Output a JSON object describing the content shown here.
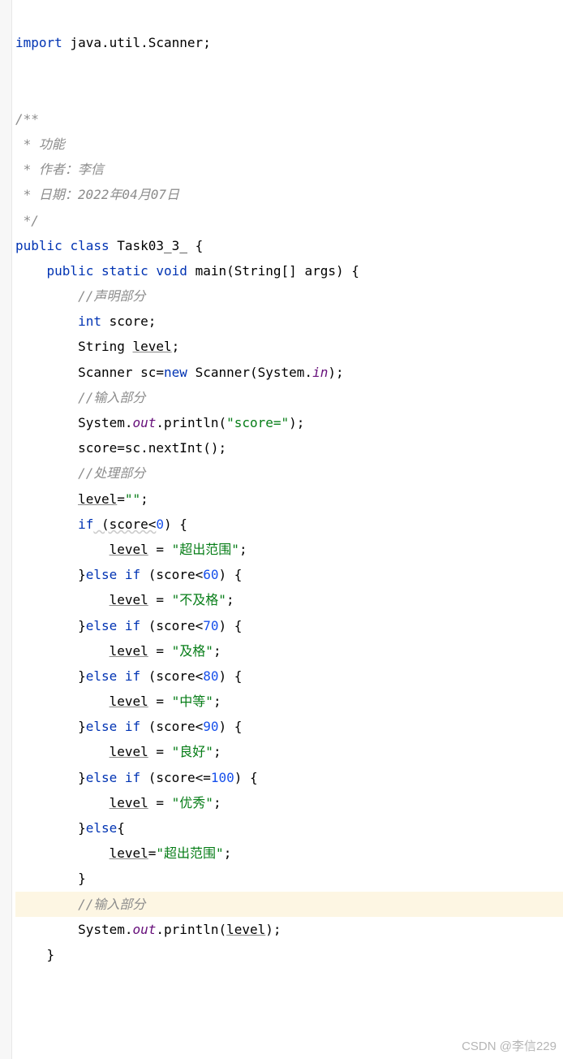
{
  "code": {
    "blank0": "",
    "import_kw": "import",
    "import_rest": " java.util.Scanner;",
    "blank1": "",
    "blank2": "",
    "jdoc_open": "/**",
    "jdoc_l1": " * 功能",
    "jdoc_l2": " * 作者：李信",
    "jdoc_l3": " * 日期：2022年04月07日",
    "jdoc_close": " */",
    "cls_kw1": "public",
    "cls_kw2": "class",
    "cls_name": "Task03_3_",
    "cls_brace": "{",
    "m_kw1": "public",
    "m_kw2": "static",
    "m_kw3": "void",
    "m_name": "main",
    "m_param": "(String[] args) {",
    "c_decl": "//声明部分",
    "d_int_kw": "int",
    "d_int_name": " score;",
    "d_str_type": "String ",
    "d_str_name": "level",
    "d_str_semi": ";",
    "sc_type": "Scanner sc=",
    "sc_new": "new",
    "sc_call": " Scanner(System.",
    "sc_in": "in",
    "sc_end": ");",
    "c_in": "//输入部分",
    "p1a": "System.",
    "p_out": "out",
    "p1b": ".println(",
    "p1_str": "\"score=\"",
    "p1c": ");",
    "read": "score=sc.nextInt();",
    "c_proc": "//处理部分",
    "lv_reset_a": "level",
    "lv_reset_b": "=",
    "lv_reset_str": "\"\"",
    "lv_reset_c": ";",
    "if_kw": "if",
    "if_cond": " (score<",
    "if_num0": "0",
    "if_tail": ") {",
    "lv": "level",
    "eq": " = ",
    "s_out": "\"超出范围\"",
    "s_fail": "\"不及格\"",
    "s_pass": "\"及格\"",
    "s_mid": "\"中等\"",
    "s_good": "\"良好\"",
    "s_exc": "\"优秀\"",
    "semi": ";",
    "else_kw": "else",
    "elif_head": "}",
    "elif_cond_lt": " (score<",
    "elif_cond_le": " (score<=",
    "num60": "60",
    "num70": "70",
    "num80": "80",
    "num90": "90",
    "num100": "100",
    "else_open": "{",
    "lv_out2_a": "level",
    "lv_out2_b": "=",
    "close_brace": "}",
    "c_in2": "//输入部分",
    "p2a": "System.",
    "p2b": ".println(",
    "p2_arg": "level",
    "p2c": ");",
    "end_main": "}"
  },
  "watermark": "CSDN @李信229"
}
